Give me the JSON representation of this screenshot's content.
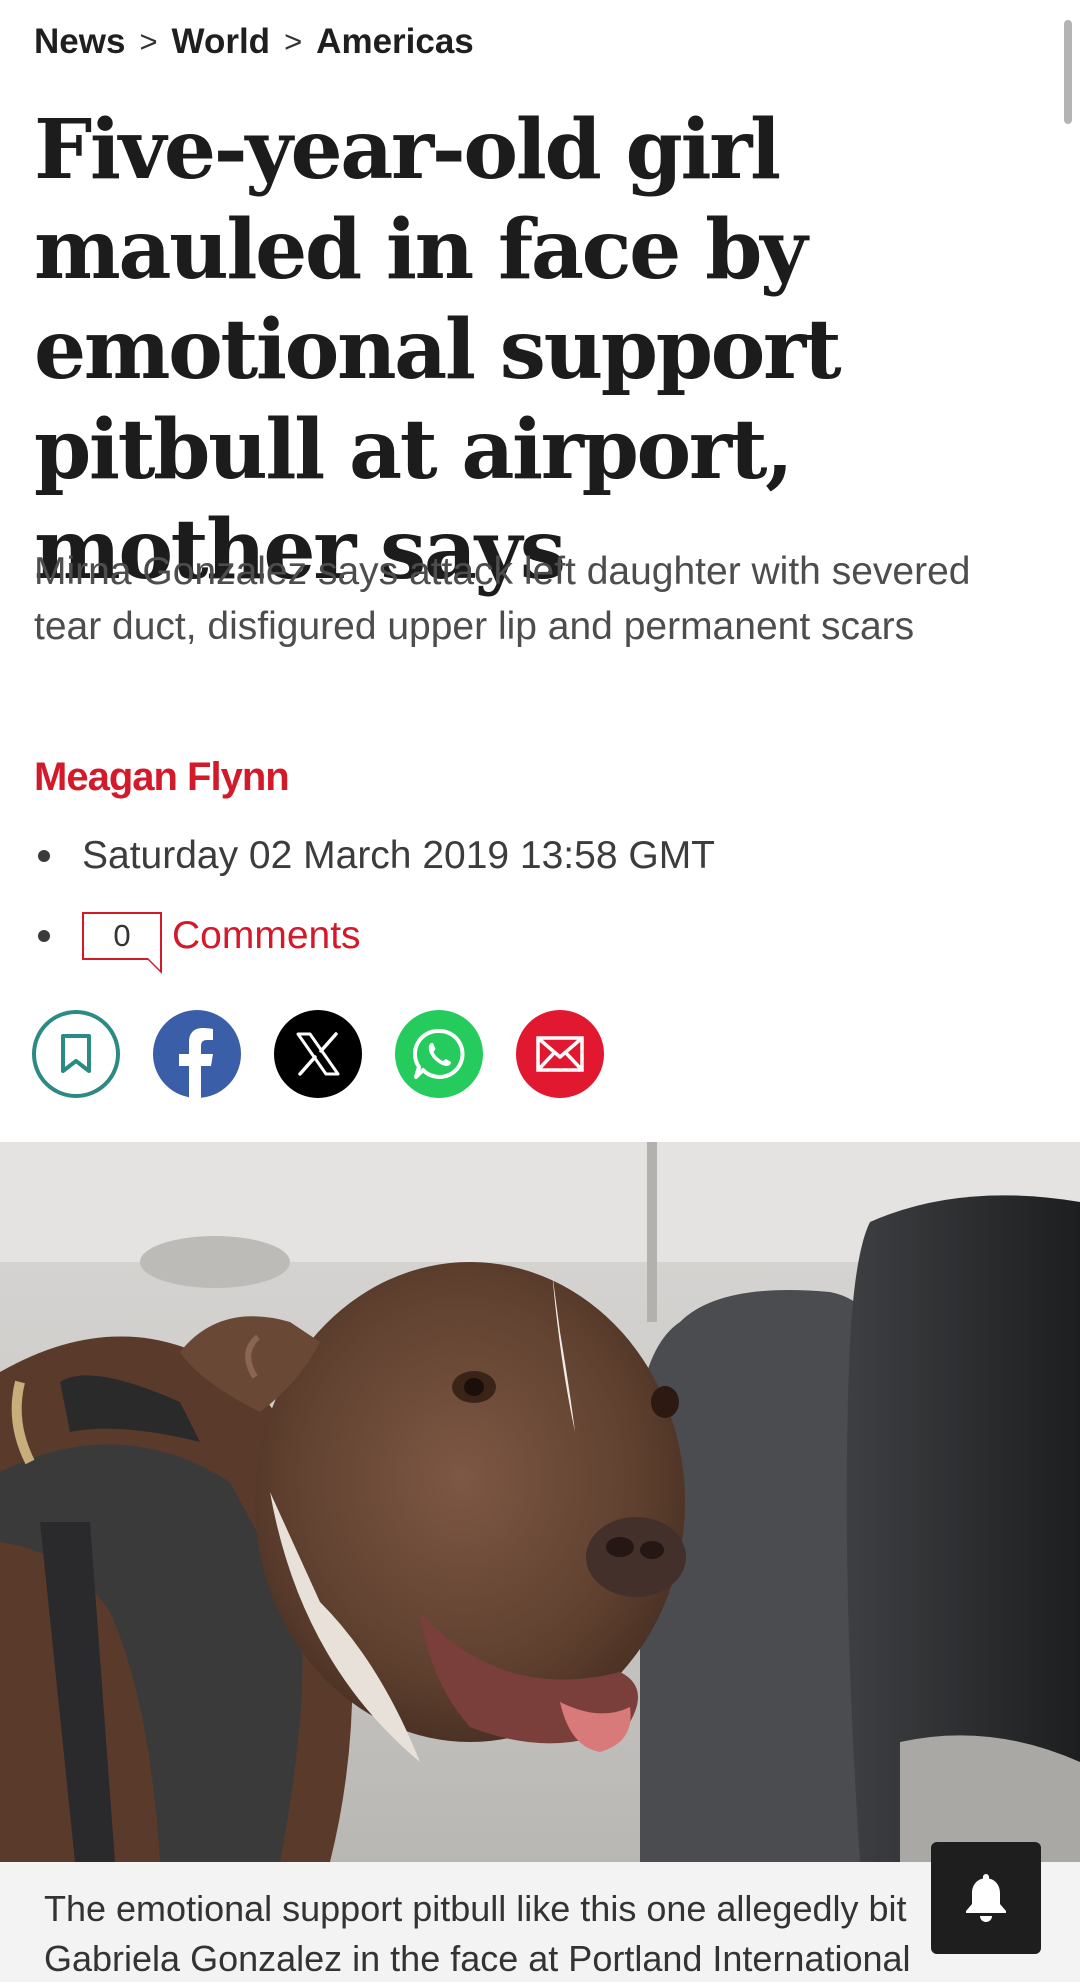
{
  "breadcrumb": {
    "items": [
      "News",
      "World",
      "Americas"
    ],
    "separator": ">"
  },
  "article": {
    "headline": "Five-year-old girl mauled in face by emotional support pitbull at airport, mother says",
    "standfirst": "Mirna Gonzalez says attack left daughter with severed tear duct, disfigured upper lip and permanent scars",
    "author": "Meagan Flynn",
    "date": "Saturday 02 March 2019 13:58 GMT",
    "comments_count": "0",
    "comments_label": "Comments"
  },
  "share": {
    "buttons": [
      {
        "name": "bookmark",
        "icon": "bookmark-icon",
        "color": "#2b8a83"
      },
      {
        "name": "facebook",
        "icon": "facebook-icon",
        "color": "#3a5ea8"
      },
      {
        "name": "x",
        "icon": "x-icon",
        "color": "#000000"
      },
      {
        "name": "whatsapp",
        "icon": "whatsapp-icon",
        "color": "#25cc5d"
      },
      {
        "name": "email",
        "icon": "envelope-icon",
        "color": "#e1182f"
      }
    ]
  },
  "hero_image": {
    "subject": "brown pitbull with white blaze wearing harness inside airplane cabin"
  },
  "caption": {
    "text": "The emotional support pitbull like this one allegedly bit Gabriela Gonzalez in the face at Portland International"
  },
  "colors": {
    "accent_red": "#d31a2a",
    "text_dark": "#1c1c1c",
    "text_grey": "#4d4d4d"
  },
  "notification_button": {
    "icon": "bell-icon"
  }
}
